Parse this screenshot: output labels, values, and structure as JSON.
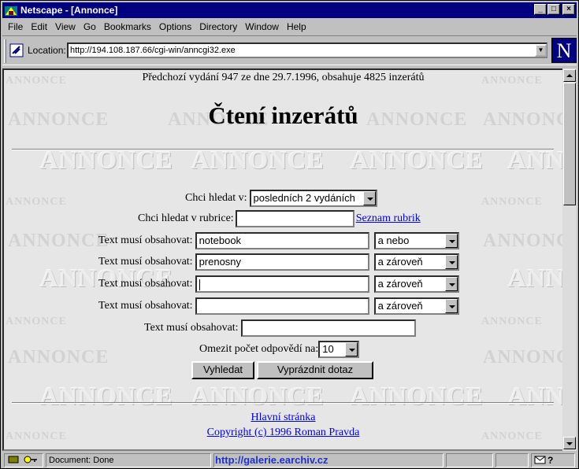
{
  "window": {
    "title": "Netscape - [Annonce]"
  },
  "menu": [
    "File",
    "Edit",
    "View",
    "Go",
    "Bookmarks",
    "Options",
    "Directory",
    "Window",
    "Help"
  ],
  "location": {
    "label": "Location:",
    "url": "http://194.108.187.66/cgi-win/anncgi32.exe"
  },
  "brand_logo": "N",
  "watermark": "ANNONCE",
  "page": {
    "prev_issue_info": "Předchozí vydání 947 ze dne 29.7.1996, obsahuje 4825 inzerátů",
    "title": "Čtení inzerátů",
    "form": {
      "search_in_label": "Chci hledat v:",
      "search_in_value": "posledních 2 vydáních",
      "category_label": "Chci hledat v rubrice:",
      "category_value": "",
      "category_link": "Seznam rubrik",
      "text_rows": [
        {
          "label": "Text musí obsahovat:",
          "value": "notebook",
          "op": "a nebo"
        },
        {
          "label": "Text musí obsahovat:",
          "value": "prenosny",
          "op": "a zároveň"
        },
        {
          "label": "Text musí obsahovat:",
          "value": "",
          "op": "a zároveň"
        },
        {
          "label": "Text musí obsahovat:",
          "value": "",
          "op": "a zároveň"
        }
      ],
      "last_text_label": "Text musí obsahovat:",
      "last_text_value": "",
      "limit_label": "Omezit počet odpovědí na:",
      "limit_value": "10",
      "search_button": "Vyhledat",
      "clear_button": "Vyprázdnit dotaz"
    },
    "footer": {
      "home_link": "Hlavní stránka",
      "copyright_link": "Copyright (c) 1996 Roman Pravda"
    }
  },
  "status": {
    "text": "Document: Done",
    "overlay_url": "http://galerie.earchiv.cz"
  },
  "colors": {
    "titlebar": "#000080",
    "link": "#0000ee",
    "chrome": "#c0c0c0"
  }
}
